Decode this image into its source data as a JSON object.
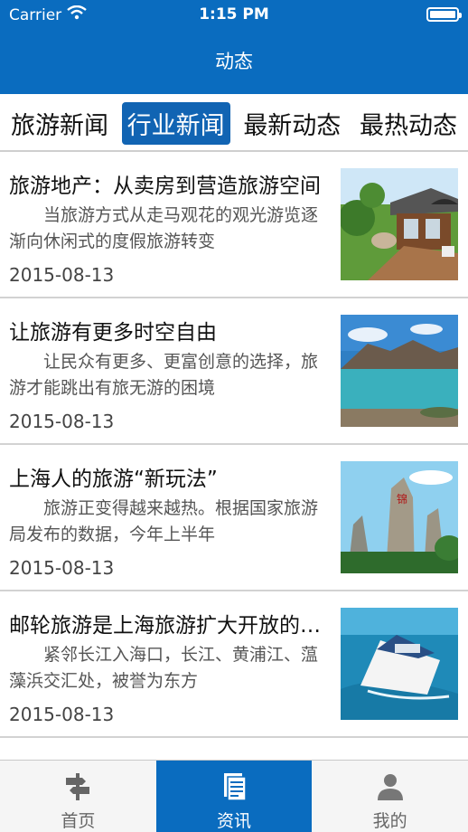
{
  "status_bar": {
    "carrier": "Carrier",
    "time": "1:15 PM"
  },
  "nav": {
    "title": "动态"
  },
  "tabs": [
    {
      "label": "旅游新闻",
      "active": false
    },
    {
      "label": "行业新闻",
      "active": true
    },
    {
      "label": "最新动态",
      "active": false
    },
    {
      "label": "最热动态",
      "active": false
    }
  ],
  "news": [
    {
      "title": "旅游地产：从卖房到营造旅游空间",
      "summary": "当旅游方式从走马观花的观光游览逐渐向休闲式的度假旅游转变",
      "date": "2015-08-13",
      "thumb": "garden-deck-photo"
    },
    {
      "title": "让旅游有更多时空自由",
      "summary": "让民众有更多、更富创意的选择，旅游才能跳出有旅无游的困境",
      "date": "2015-08-13",
      "thumb": "lake-mountain-photo"
    },
    {
      "title": "上海人的旅游“新玩法”",
      "summary": "旅游正变得越来越热。根据国家旅游局发布的数据，今年上半年",
      "date": "2015-08-13",
      "thumb": "rock-landmark-photo"
    },
    {
      "title": "邮轮旅游是上海旅游扩大开放的窗口",
      "summary": "紧邻长江入海口，长江、黄浦江、蕰藻浜交汇处，被誉为东方",
      "date": "2015-08-13",
      "thumb": "cruise-ship-photo"
    }
  ],
  "tabbar": [
    {
      "label": "首页",
      "icon": "signpost-icon",
      "active": false
    },
    {
      "label": "资讯",
      "icon": "document-icon",
      "active": true
    },
    {
      "label": "我的",
      "icon": "user-icon",
      "active": false
    }
  ],
  "colors": {
    "primary": "#0a6cbf",
    "active_tab": "#1164b3",
    "text": "#111111",
    "muted": "#555555"
  }
}
